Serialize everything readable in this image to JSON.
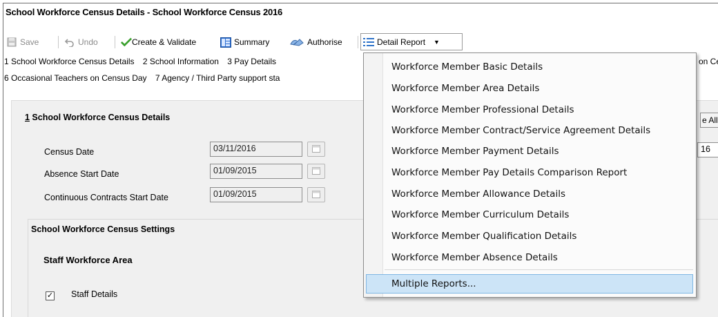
{
  "window": {
    "title": "School Workforce Census Details - School Workforce Census 2016"
  },
  "toolbar": {
    "save": "Save",
    "undo": "Undo",
    "create_validate": "Create & Validate",
    "summary": "Summary",
    "authorise": "Authorise",
    "detail_report": "Detail Report"
  },
  "nav": {
    "row1": [
      "1 School Workforce Census Details",
      "2 School Information",
      "3 Pay Details"
    ],
    "row1_tail": "on Ce",
    "row2": [
      "6 Occasional Teachers on Census Day",
      "7 Agency / Third Party support sta"
    ]
  },
  "section": {
    "number": "1",
    "title": " School Workforce Census Details",
    "fields": [
      {
        "label": "Census Date",
        "value": "03/11/2016"
      },
      {
        "label": "Absence Start Date",
        "value": "01/09/2015"
      },
      {
        "label": "Continuous Contracts Start Date",
        "value": "01/09/2015"
      }
    ],
    "right_button": "e All",
    "right_field": "16"
  },
  "settings": {
    "title": "School Workforce Census Settings",
    "area_title": "Staff Workforce Area",
    "checkboxes": [
      {
        "label": "Staff Details",
        "checked": true
      }
    ]
  },
  "dropdown": {
    "items": [
      "Workforce Member Basic Details",
      "Workforce Member Area Details",
      "Workforce Member Professional Details",
      "Workforce Member Contract/Service Agreement Details",
      "Workforce Member Payment Details",
      "Workforce Member Pay Details Comparison Report",
      "Workforce Member Allowance Details",
      "Workforce Member Curriculum Details",
      "Workforce Member Qualification Details",
      "Workforce Member Absence Details"
    ],
    "multiple": "Multiple Reports...",
    "highlight_color": "#cce4f7"
  }
}
